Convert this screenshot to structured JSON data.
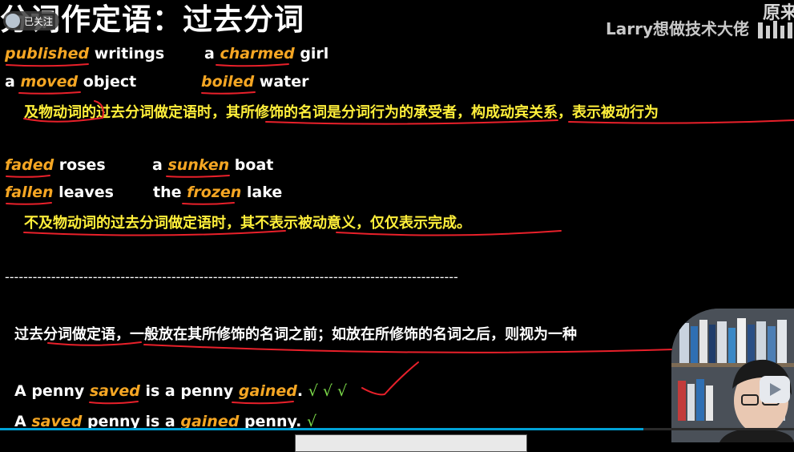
{
  "slide": {
    "title": "分词作定语：过去分词",
    "watermark": "Larry想做技术大佬",
    "corner_text": "原来",
    "follow_badge": "已关注",
    "rows": [
      {
        "a_pre": "",
        "a_hl": "published",
        "a_post": " writings",
        "b_pre": "a ",
        "b_hl": "charmed",
        "b_post": " girl"
      },
      {
        "a_pre": "a ",
        "a_hl": "moved",
        "a_post": " object",
        "b_pre": "",
        "b_hl": "boiled",
        "b_post": "  water"
      },
      {
        "a_pre": "",
        "a_hl": "faded",
        "a_post": " roses",
        "b_pre": "a ",
        "b_hl": "sunken",
        "b_post": " boat"
      },
      {
        "a_pre": "",
        "a_hl": "fallen",
        "a_post": " leaves",
        "b_pre": "the ",
        "b_hl": "frozen",
        "b_post": " lake"
      }
    ],
    "note1": "及物动词的过去分词做定语时，其所修饰的名词是分词行为的承受者，构成动宾关系，表示被动行为",
    "note2": "不及物动词的过去分词做定语时，其不表示被动意义，仅仅表示完成。",
    "divider": "--------------------------------------------------------------------------------------------------",
    "note3": "过去分词做定语，一般放在其所修饰的名词之前；如放在所修饰的名词之后，则视为一种",
    "example1": {
      "pre": "A penny ",
      "hl1": "saved",
      "mid": " is a penny ",
      "hl2": "gained",
      "post": ".",
      "checks": "√ √ √"
    },
    "example2": {
      "pre": "A ",
      "hl1": "saved",
      "mid": " penny is a ",
      "hl2": "gained",
      "post": " penny.",
      "checks": "√"
    }
  },
  "colors": {
    "highlight": "#f5a623",
    "note": "#ffef3a",
    "ink": "#e8202a",
    "check": "#7ddc4a",
    "progress": "#00a1d6"
  },
  "player": {
    "progress": 0.81
  }
}
